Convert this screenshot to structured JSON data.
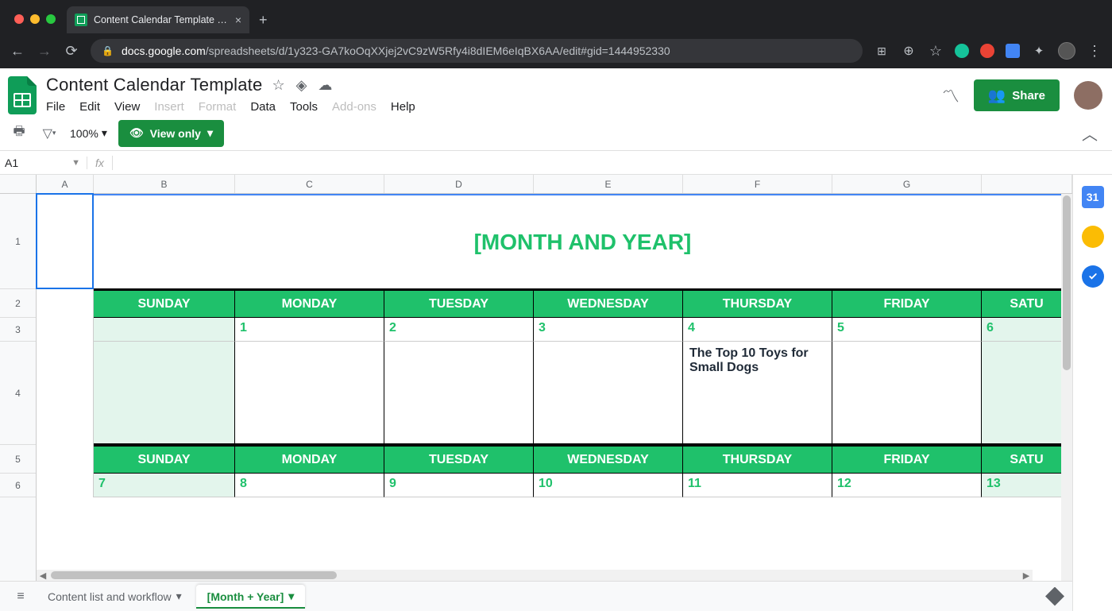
{
  "browser": {
    "tab_title": "Content Calendar Template - G",
    "url_domain": "docs.google.com",
    "url_path": "/spreadsheets/d/1y323-GA7koOqXXjej2vC9zW5Rfy4i8dIEM6eIqBX6AA/edit#gid=1444952330"
  },
  "doc": {
    "title": "Content Calendar Template",
    "menus": [
      "File",
      "Edit",
      "View",
      "Insert",
      "Format",
      "Data",
      "Tools",
      "Add-ons",
      "Help"
    ],
    "disabled_menus": [
      "Insert",
      "Format",
      "Add-ons"
    ],
    "share_label": "Share",
    "zoom": "100%",
    "view_only": "View only",
    "name_box": "A1",
    "formula": ""
  },
  "columns": [
    "A",
    "B",
    "C",
    "D",
    "E",
    "F",
    "G"
  ],
  "row_labels": [
    "1",
    "2",
    "3",
    "4",
    "5",
    "6"
  ],
  "calendar": {
    "title": "[MONTH AND YEAR]",
    "days": [
      "SUNDAY",
      "MONDAY",
      "TUESDAY",
      "WEDNESDAY",
      "THURSDAY",
      "FRIDAY",
      "SATU"
    ],
    "week1_nums": [
      "",
      "1",
      "2",
      "3",
      "4",
      "5",
      "6"
    ],
    "week1_content": [
      "",
      "",
      "",
      "",
      "The Top 10 Toys for Small Dogs",
      "",
      ""
    ],
    "week2_nums": [
      "7",
      "8",
      "9",
      "10",
      "11",
      "12",
      "13"
    ]
  },
  "sheets": {
    "tab1": "Content list and workflow",
    "tab2": "[Month + Year]"
  },
  "col_widths": {
    "A": 72,
    "B": 178,
    "other": 188
  }
}
